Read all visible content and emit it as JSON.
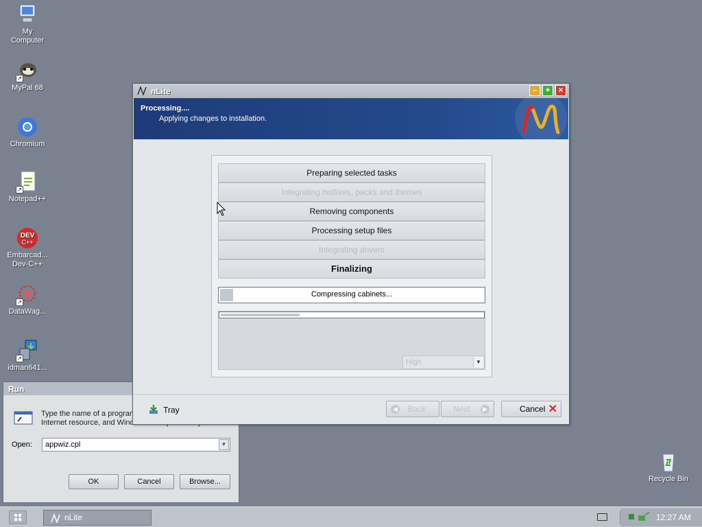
{
  "desktop": {
    "icons": [
      {
        "label": "My Computer"
      },
      {
        "label": "MyPal 68"
      },
      {
        "label": "Chromium"
      },
      {
        "label": "Notepad++"
      },
      {
        "label": "Embarcad...\nDev-C++"
      },
      {
        "label": "DataWag..."
      },
      {
        "label": "idman641..."
      },
      {
        "label": "Recycle Bin"
      }
    ]
  },
  "run_dialog": {
    "title": "Run",
    "description": "Type the name of a program, folder, document, or Internet resource, and Windows will open it for you.",
    "open_label": "Open:",
    "open_value": "appwiz.cpl",
    "ok": "OK",
    "cancel": "Cancel",
    "browse": "Browse..."
  },
  "nlite": {
    "title": "nLite",
    "header": {
      "title": "Processing....",
      "subtitle": "Applying changes to installation."
    },
    "tasks": [
      {
        "label": "Preparing selected tasks",
        "state": "done"
      },
      {
        "label": "Integrating hotfixes, packs and themes",
        "state": "skipped"
      },
      {
        "label": "Removing components",
        "state": "done"
      },
      {
        "label": "Processing setup files",
        "state": "done"
      },
      {
        "label": "Integrating drivers",
        "state": "skipped"
      },
      {
        "label": "Finalizing",
        "state": "active"
      }
    ],
    "progress_text": "Compressing cabinets...",
    "progress_fraction": 0.05,
    "sub_progress_fraction": 0.3,
    "priority": "High",
    "tray": "Tray",
    "back": "Back",
    "next": "Next",
    "cancel": "Cancel"
  },
  "taskbar": {
    "task_label": "nLite",
    "clock": "12:27 AM"
  },
  "colors": {
    "desktop": "#7a828f",
    "header": "#1e3b7a",
    "cancel_x": "#d9262b"
  }
}
